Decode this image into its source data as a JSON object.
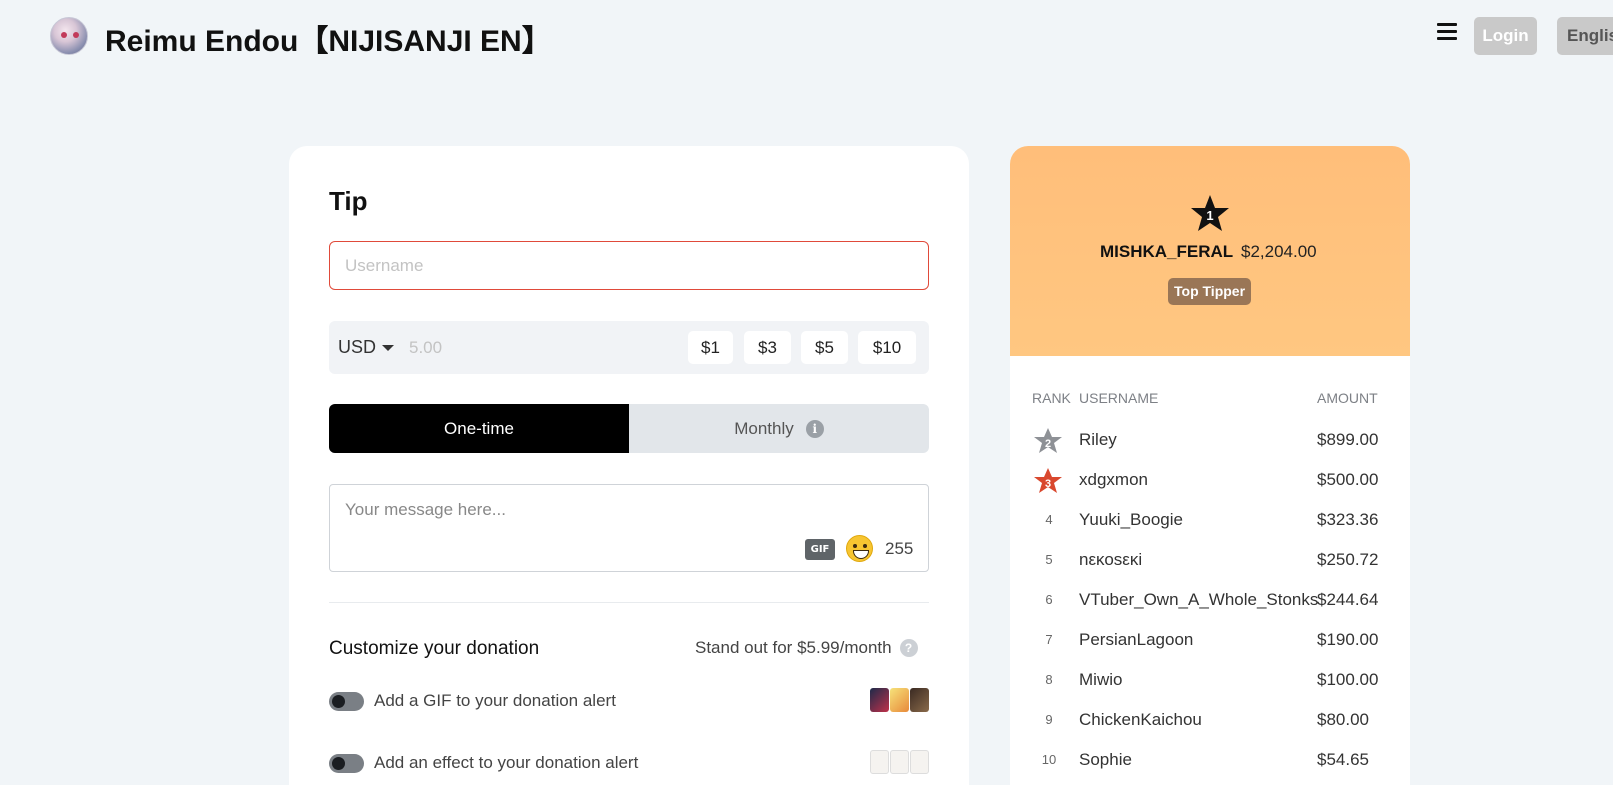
{
  "header": {
    "title": "Reimu Endou【NIJISANJI EN】",
    "login_label": "Login",
    "language_label": "Englis"
  },
  "tip": {
    "title": "Tip",
    "username_placeholder": "Username",
    "currency": "USD",
    "amount_placeholder": "5.00",
    "presets": [
      "$1",
      "$3",
      "$5",
      "$10"
    ],
    "frequency": {
      "one_time": "One-time",
      "monthly": "Monthly",
      "selected": "One-time"
    },
    "message_placeholder": "Your message here...",
    "gif_label": "GIF",
    "char_remaining": "255",
    "customize_title": "Customize your donation",
    "standout_text": "Stand out for $5.99/month",
    "options": [
      {
        "label": "Add a GIF to your donation alert",
        "enabled": false
      },
      {
        "label": "Add an effect to your donation alert",
        "enabled": false
      }
    ]
  },
  "leaderboard": {
    "top": {
      "rank": "1",
      "username": "MISHKA_FERAL",
      "amount": "$2,204.00",
      "badge": "Top Tipper"
    },
    "columns": {
      "rank": "RANK",
      "username": "USERNAME",
      "amount": "AMOUNT"
    },
    "rows": [
      {
        "rank": "2",
        "username": "Riley",
        "amount": "$899.00",
        "icon": "silver-star-icon"
      },
      {
        "rank": "3",
        "username": "xdgxmon",
        "amount": "$500.00",
        "icon": "bronze-star-icon"
      },
      {
        "rank": "4",
        "username": "Yuuki_Boogie",
        "amount": "$323.36"
      },
      {
        "rank": "5",
        "username": "nεκοsεκi",
        "amount": "$250.72"
      },
      {
        "rank": "6",
        "username": "VTuber_Own_A_Whole_Stonks",
        "amount": "$244.64"
      },
      {
        "rank": "7",
        "username": "PersianLagoon",
        "amount": "$190.00"
      },
      {
        "rank": "8",
        "username": "Miwio",
        "amount": "$100.00"
      },
      {
        "rank": "9",
        "username": "ChickenKaichou",
        "amount": "$80.00"
      },
      {
        "rank": "10",
        "username": "Sophie",
        "amount": "$54.65"
      }
    ]
  },
  "colors": {
    "accent_black": "#000000",
    "leaderboard_top_bg": "#ffc07c",
    "badge_bg": "#9a7656",
    "input_error_border": "#e04a3a",
    "silver_star": "#8e9196",
    "bronze_star": "#d9482e"
  }
}
